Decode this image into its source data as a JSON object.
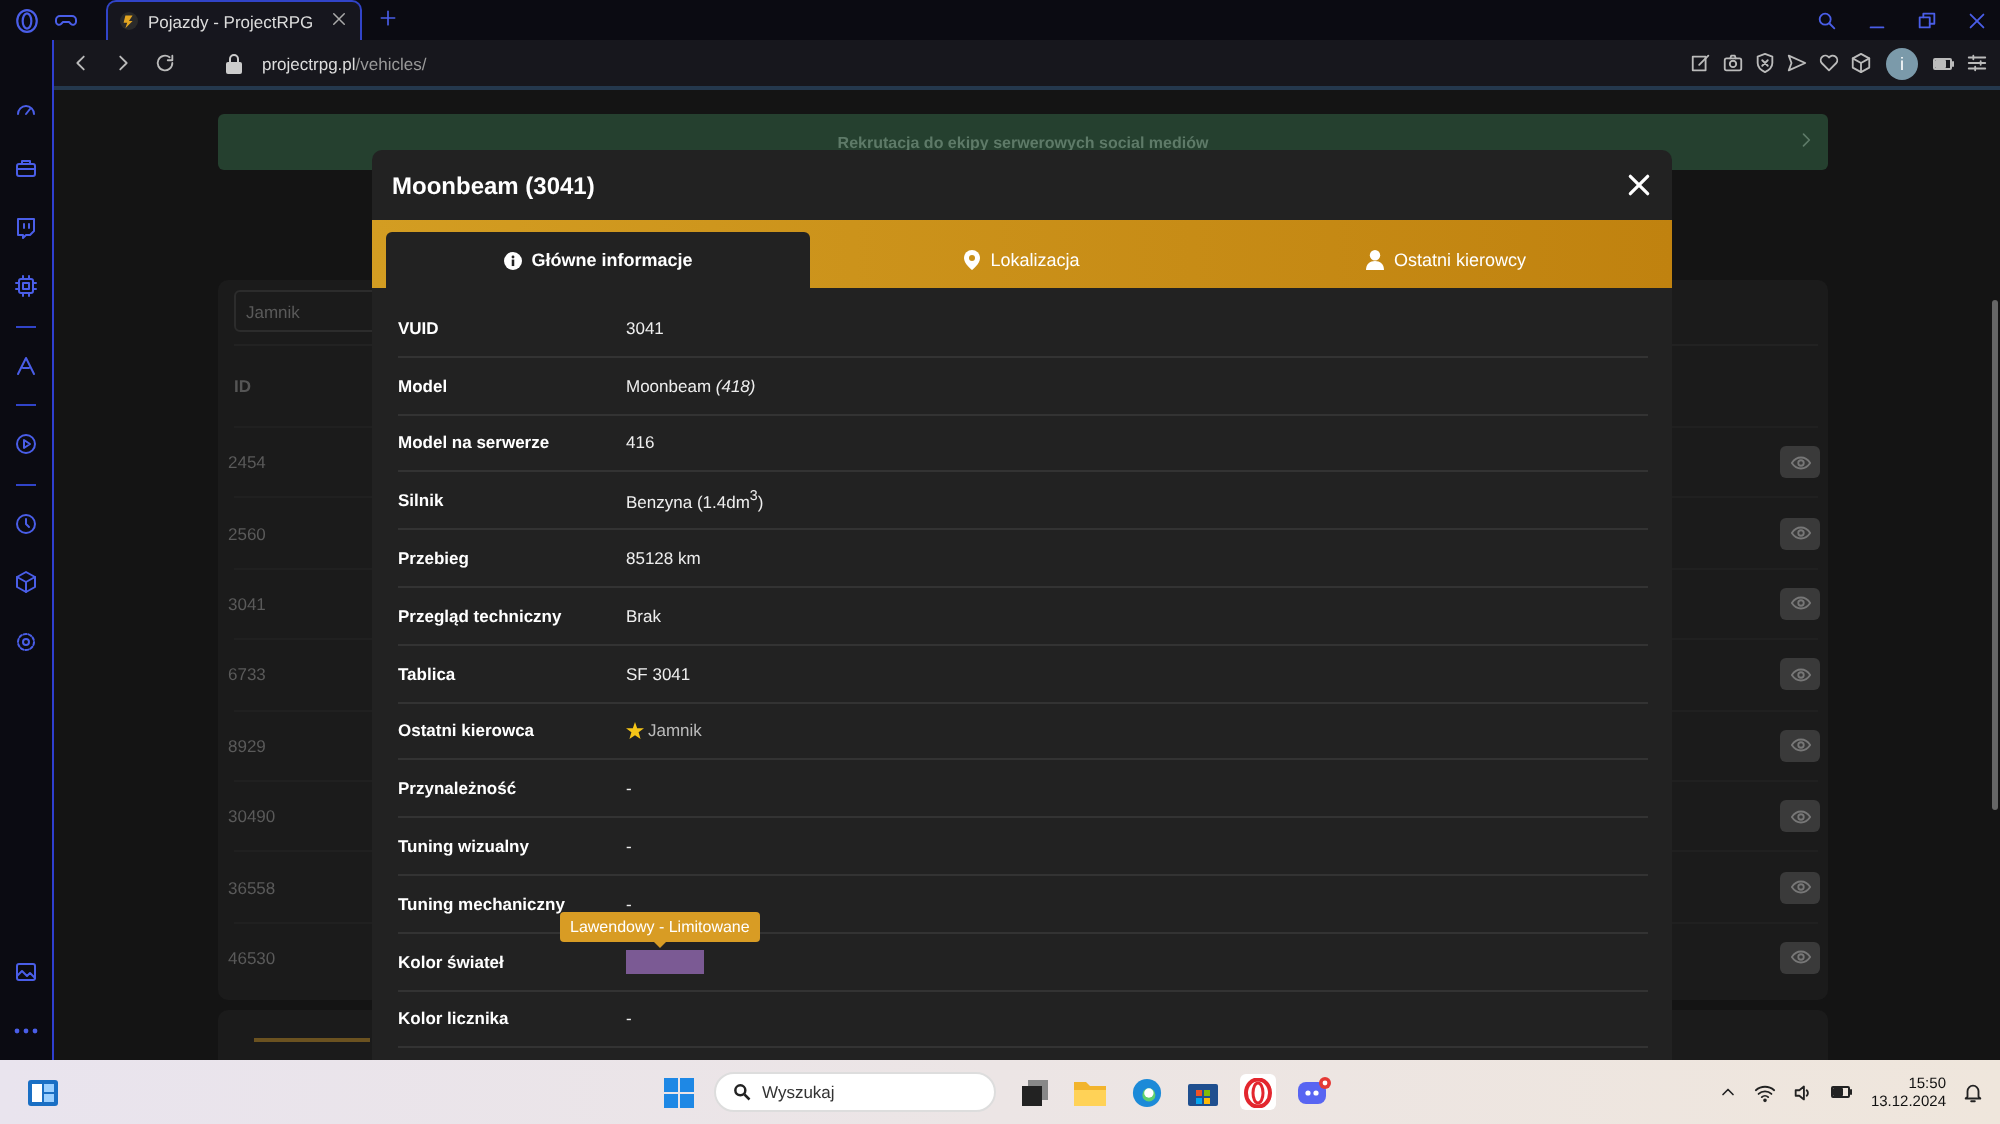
{
  "browser": {
    "tab": {
      "title": "Pojazdy - ProjectRPG",
      "selected": true
    },
    "url": {
      "domain": "projectrpg.pl",
      "path": "/vehicles/"
    },
    "profile": "i"
  },
  "banner": {
    "text": "Rekrutacja do ekipy serwerowych social mediów"
  },
  "vehicle_list": {
    "search": {
      "value": "Jamnik"
    },
    "columns": [
      "ID"
    ],
    "rows": [
      {
        "id": "2454"
      },
      {
        "id": "2560"
      },
      {
        "id": "3041"
      },
      {
        "id": "6733"
      },
      {
        "id": "8929"
      },
      {
        "id": "30490"
      },
      {
        "id": "36558"
      },
      {
        "id": "46530"
      }
    ]
  },
  "modal": {
    "title": "Moonbeam (3041)",
    "tabs": [
      {
        "label": "Główne informacje",
        "kind": "info",
        "selected": true
      },
      {
        "label": "Lokalizacja",
        "kind": "location",
        "selected": false
      },
      {
        "label": "Ostatni kierowcy",
        "kind": "drivers",
        "selected": false
      }
    ],
    "fields": [
      {
        "kind": "text",
        "label": "VUID",
        "value": "3041"
      },
      {
        "kind": "text",
        "label": "Model",
        "value": "Moonbeam *(418)*"
      },
      {
        "kind": "text",
        "label": "Model na serwerze",
        "value": "416"
      },
      {
        "kind": "text",
        "label": "Silnik",
        "value": "Benzyna (1.4dm$^{3}$)"
      },
      {
        "kind": "text",
        "label": "Przebieg",
        "value": "85128 km"
      },
      {
        "kind": "text",
        "label": "Przegląd techniczny",
        "value": "Brak"
      },
      {
        "kind": "text",
        "label": "Tablica",
        "value": "SF 3041"
      },
      {
        "kind": "driver",
        "label": "Ostatni kierowca",
        "value": "Jamnik"
      },
      {
        "kind": "text",
        "label": "Przynależność",
        "value": "-"
      },
      {
        "kind": "text",
        "label": "Tuning wizualny",
        "value": "-"
      },
      {
        "kind": "text",
        "label": "Tuning mechaniczny",
        "value": "-"
      },
      {
        "kind": "color",
        "label": "Kolor świateł",
        "color": "#7b5a94",
        "tooltip": "Lawendowy - Limitowane"
      },
      {
        "kind": "text",
        "label": "Kolor licznika",
        "value": "-"
      }
    ]
  },
  "taskbar": {
    "search": {
      "placeholder": "Wyszukaj"
    },
    "time": "15:50",
    "date": "13.12.2024"
  }
}
